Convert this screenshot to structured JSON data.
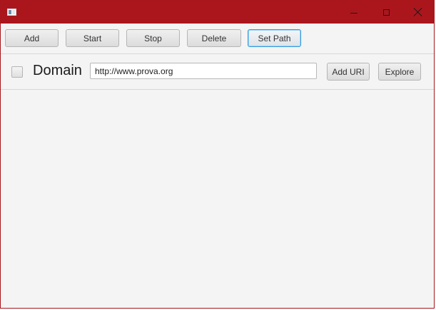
{
  "window": {
    "title": "",
    "title_bar_color": "#ab161d",
    "controls": {
      "minimize_icon": "minimize-icon",
      "maximize_icon": "maximize-icon",
      "close_icon": "close-icon"
    }
  },
  "toolbar": {
    "buttons": [
      {
        "label": "Add"
      },
      {
        "label": "Start"
      },
      {
        "label": "Stop"
      },
      {
        "label": "Delete"
      },
      {
        "label": "Set Path",
        "focused": true
      }
    ]
  },
  "domain_row": {
    "checkbox_checked": false,
    "label": "Domain",
    "url_value": "http://www.prova.org",
    "add_uri_label": "Add URI",
    "explore_label": "Explore"
  }
}
